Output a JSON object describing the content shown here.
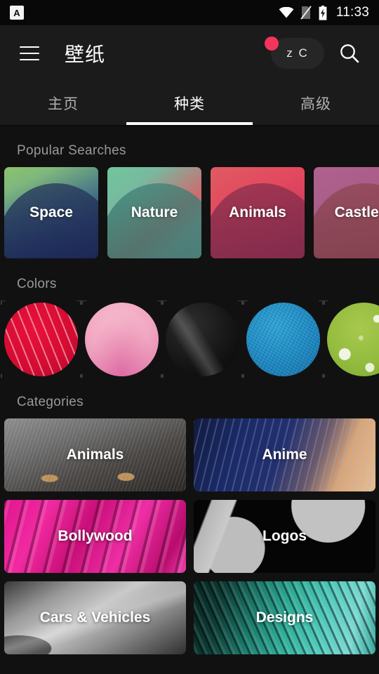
{
  "status_bar": {
    "notification_icon": "app-notification-icon",
    "notification_glyph": "A",
    "icons": [
      "wifi-icon",
      "sim-off-icon",
      "battery-charging-icon"
    ],
    "time": "11:33"
  },
  "app_bar": {
    "menu_icon": "hamburger-menu-icon",
    "title": "壁纸",
    "chip_text": "z C",
    "chip_badge": true,
    "badge_color": "#f2355c",
    "search_icon": "search-icon"
  },
  "tabs": [
    {
      "label": "主页",
      "active": false
    },
    {
      "label": "种类",
      "active": true
    },
    {
      "label": "高级",
      "active": false
    }
  ],
  "sections": {
    "popular_searches": {
      "title": "Popular Searches",
      "items": [
        {
          "label": "Space",
          "art": "art-space",
          "wave": "art-space-w"
        },
        {
          "label": "Nature",
          "art": "art-nature",
          "wave": "art-nature-w"
        },
        {
          "label": "Animals",
          "art": "art-animals",
          "wave": "art-animals-w"
        },
        {
          "label": "Castles",
          "art": "art-castles",
          "wave": "art-castles-w"
        }
      ]
    },
    "colors": {
      "title": "Colors",
      "items": [
        {
          "name": "red-swatch",
          "color": "#d60c33",
          "art": "art-c-red",
          "tex": "tex-streaks"
        },
        {
          "name": "pink-swatch",
          "color": "#f2a9c2",
          "art": "art-c-pink",
          "tex": "tex-softpink"
        },
        {
          "name": "black-swatch",
          "color": "#1a1a1a",
          "art": "art-c-black",
          "tex": "tex-sheen"
        },
        {
          "name": "blue-swatch",
          "color": "#1f8bc4",
          "art": "art-c-blue",
          "tex": "tex-grain"
        },
        {
          "name": "green-swatch",
          "color": "#93bc3e",
          "art": "art-c-green",
          "tex": "tex-drops"
        }
      ]
    },
    "categories": {
      "title": "Categories",
      "items": [
        {
          "label": "Animals",
          "art": "art-cat-animals",
          "fx": "fx-fur"
        },
        {
          "label": "Anime",
          "art": "art-cat-anime",
          "fx": "fx-hair"
        },
        {
          "label": "Bollywood",
          "art": "art-cat-bolly",
          "fx": "fx-folds"
        },
        {
          "label": "Logos",
          "art": "art-cat-logos",
          "fx": "fx-logos"
        },
        {
          "label": "Cars & Vehicles",
          "art": "art-cat-cars",
          "fx": "fx-cars"
        },
        {
          "label": "Designs",
          "art": "art-cat-designs",
          "fx": "fx-designs"
        }
      ]
    }
  },
  "theme": {
    "background": "#111111",
    "appbar_background": "#1b1b1b",
    "accent": "#f2355c",
    "text_primary": "#ffffff",
    "text_secondary": "#999999"
  }
}
